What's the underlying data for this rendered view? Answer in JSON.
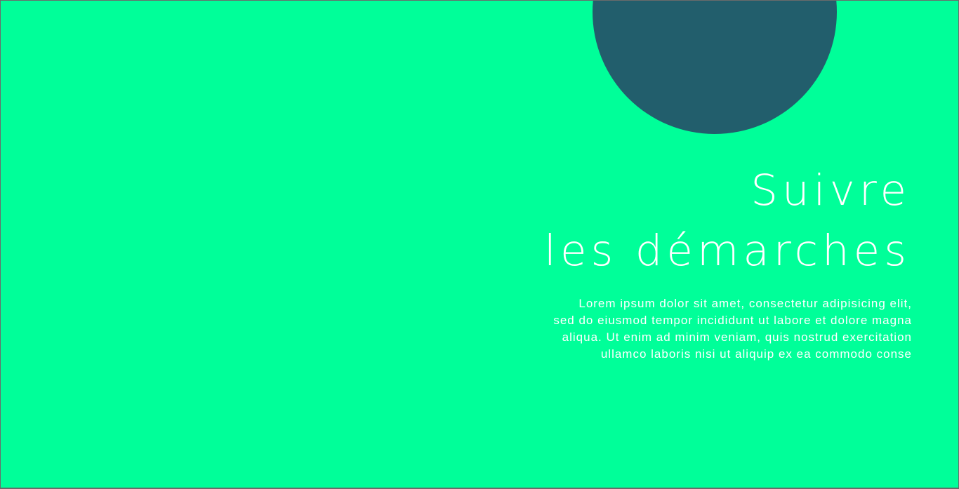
{
  "colors": {
    "background": "#00ff99",
    "circle": "#225e6c",
    "text": "#ffffff"
  },
  "hero": {
    "title_lines": [
      "Suivre",
      "les démarches"
    ],
    "paragraph_lines": [
      "Lorem ipsum dolor sit amet, consectetur adipisicing elit,",
      "sed do eiusmod tempor incididunt ut labore et dolore magna",
      "aliqua. Ut enim ad minim veniam, quis nostrud exercitation",
      "ullamco laboris nisi ut aliquip ex ea commodo conse"
    ]
  }
}
